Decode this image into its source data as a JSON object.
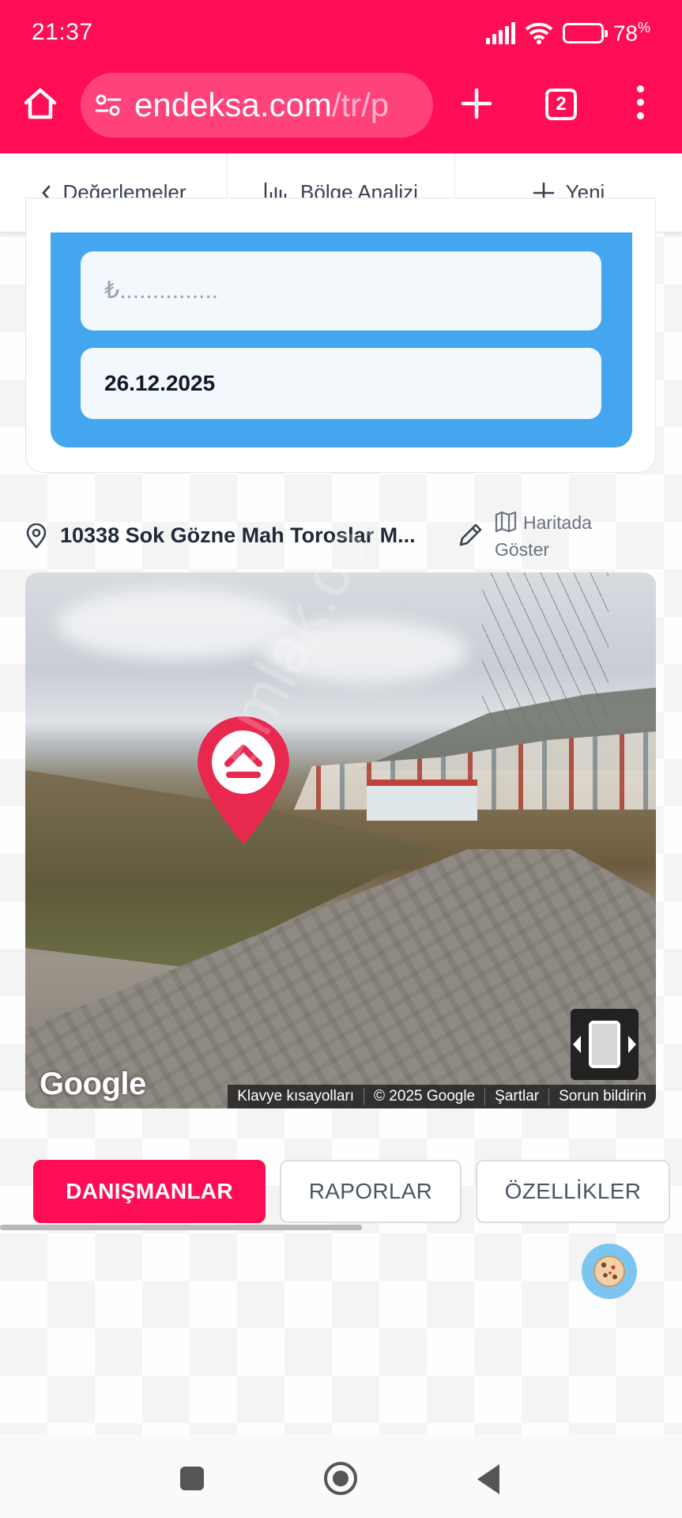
{
  "status_bar": {
    "time": "21:37",
    "battery": "78",
    "battery_unit": "%"
  },
  "browser": {
    "url_main": "endeksa.com",
    "url_dim": "/tr/p",
    "tab_count": "2"
  },
  "app_nav": {
    "back_label": "Değerlemeler",
    "analysis_label": "Bölge Analizi",
    "new_label": "Yeni"
  },
  "form": {
    "price_placeholder": "₺...............",
    "date_value": "26.12.2025"
  },
  "address": {
    "text": "10338 Sok Gözne Mah Toroslar M...",
    "map_link_line1": "Haritada",
    "map_link_line2": "Göster"
  },
  "streetview": {
    "google_logo": "Google",
    "attribution": [
      "Klavye kısayolları",
      "© 2025 Google",
      "Şartlar",
      "Sorun bildirin"
    ],
    "watermark": "emlak.com"
  },
  "tabs": [
    {
      "label": "DANIŞMANLAR",
      "active": true
    },
    {
      "label": "RAPORLAR",
      "active": false
    },
    {
      "label": "ÖZELLİKLER",
      "active": false
    }
  ],
  "colors": {
    "brand": "#ff0d55",
    "panel_blue": "#45a6f0"
  }
}
